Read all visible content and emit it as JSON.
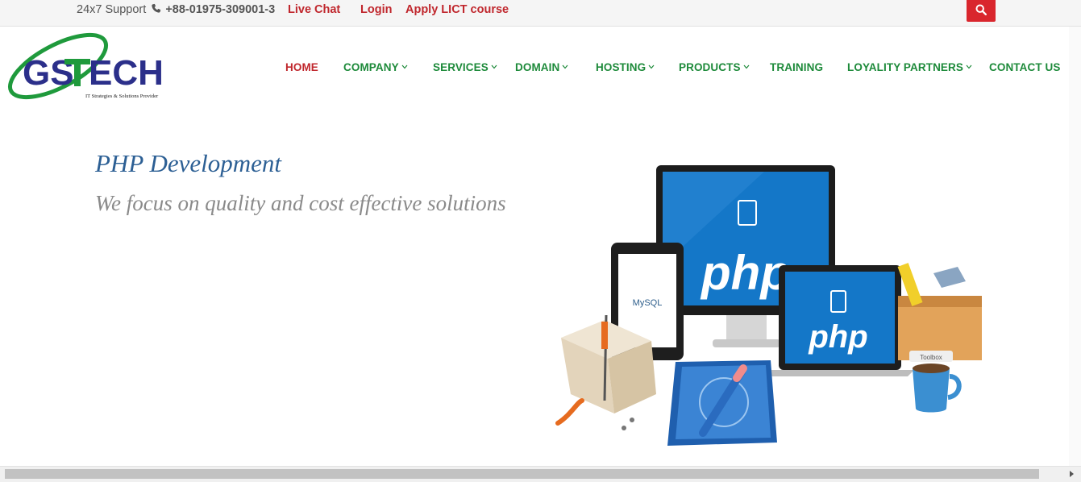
{
  "topbar": {
    "support_label": "24x7 Support",
    "phone": "+88-01975-309001-3",
    "live_chat": "Live Chat",
    "login": "Login",
    "apply": "Apply LICT course"
  },
  "logo": {
    "text": "GS TECH",
    "tagline": "IT Strategies & Solutions Provider"
  },
  "nav": {
    "items": [
      {
        "label": "HOME",
        "dropdown": false,
        "active": true
      },
      {
        "label": "COMPANY",
        "dropdown": true
      },
      {
        "label": "SERVICES",
        "dropdown": true
      },
      {
        "label": "DOMAIN",
        "dropdown": true
      },
      {
        "label": "HOSTING",
        "dropdown": true
      },
      {
        "label": "PRODUCTS",
        "dropdown": true
      },
      {
        "label": "TRAINING",
        "dropdown": false
      },
      {
        "label": "LOYALITY PARTNERS",
        "dropdown": true
      },
      {
        "label": "CONTACT US",
        "dropdown": false
      }
    ]
  },
  "hero": {
    "title": "PHP Development",
    "subtitle": "We focus on quality and cost effective solutions",
    "illustration": {
      "monitor_text": "php",
      "laptop_text": "php",
      "tablet_text": "MySQL",
      "toolbox_label": "Toolbox"
    }
  },
  "colors": {
    "accent_red": "#c0272d",
    "nav_green": "#1d8a3a",
    "search_red": "#d9262d",
    "logo_blue": "#2b2f8a",
    "hero_title_blue": "#2c5f94"
  },
  "icons": [
    "phone-icon",
    "search-icon",
    "chevron-down-icon"
  ]
}
